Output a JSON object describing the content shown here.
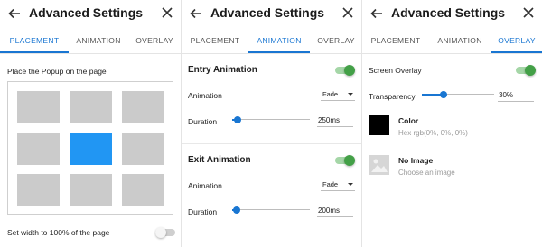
{
  "colors": {
    "accent": "#1976d2",
    "toggle_on": "#43a047",
    "selected_cell": "#2196f3",
    "cell": "#cbcbcb",
    "overlay_color": "#000000"
  },
  "panels": [
    {
      "title": "Advanced Settings",
      "tabs": [
        "PLACEMENT",
        "ANIMATION",
        "OVERLAY"
      ],
      "active_tab": "PLACEMENT",
      "placement": {
        "heading": "Place the Popup on the page",
        "grid": {
          "rows": 3,
          "cols": 3,
          "selected_row": 2,
          "selected_col": 2
        },
        "width_label": "Set width to 100% of the page",
        "width_toggle": false
      }
    },
    {
      "title": "Advanced Settings",
      "tabs": [
        "PLACEMENT",
        "ANIMATION",
        "OVERLAY"
      ],
      "active_tab": "ANIMATION",
      "entry": {
        "title": "Entry Animation",
        "enabled": true,
        "animation_label": "Animation",
        "animation_value": "Fade",
        "duration_label": "Duration",
        "duration_value": "250ms",
        "duration_fraction": 0.07
      },
      "exit": {
        "title": "Exit Animation",
        "enabled": true,
        "animation_label": "Animation",
        "animation_value": "Fade",
        "duration_label": "Duration",
        "duration_value": "200ms",
        "duration_fraction": 0.06
      }
    },
    {
      "title": "Advanced Settings",
      "tabs": [
        "PLACEMENT",
        "ANIMATION",
        "OVERLAY"
      ],
      "active_tab": "OVERLAY",
      "overlay": {
        "screen_overlay_label": "Screen Overlay",
        "screen_overlay_enabled": true,
        "transparency_label": "Transparency",
        "transparency_value": "30%",
        "transparency_fraction": 0.3,
        "color_label": "Color",
        "color_value": "Hex rgb(0%, 0%, 0%)",
        "image_label": "No Image",
        "image_hint": "Choose an image"
      }
    }
  ]
}
